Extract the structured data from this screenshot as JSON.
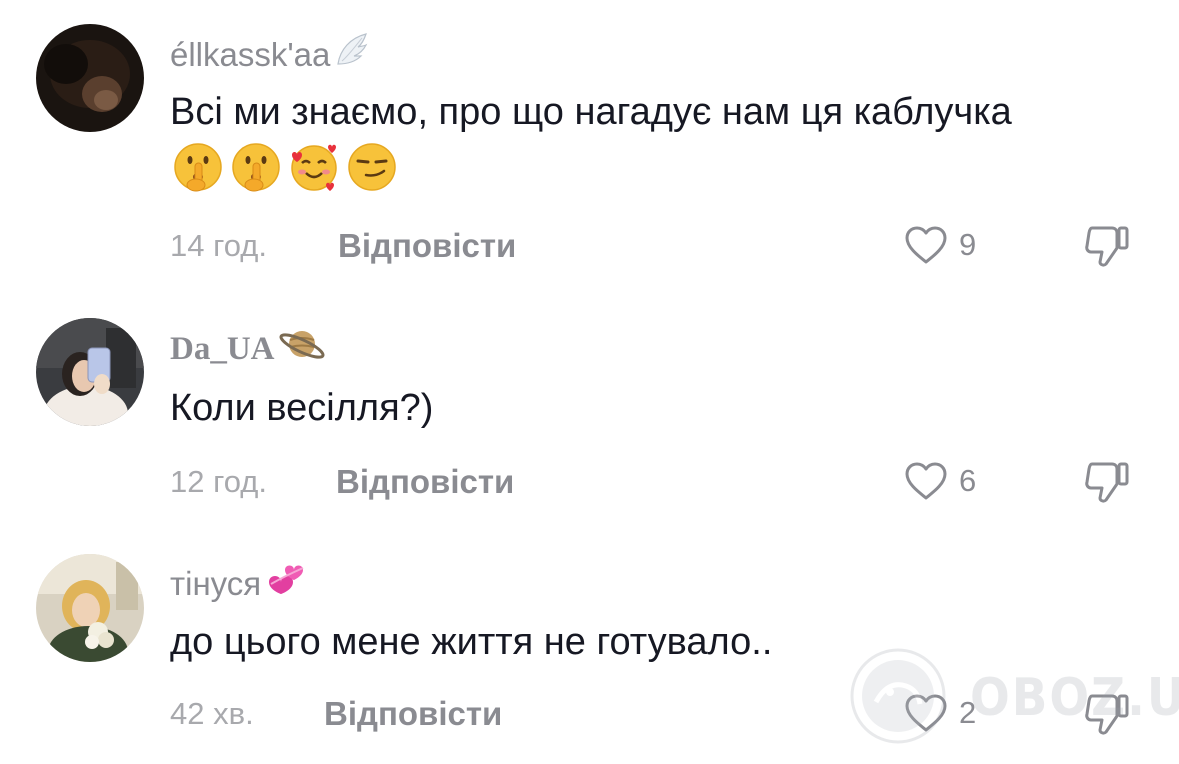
{
  "comments": [
    {
      "username": "éllkassk'aa",
      "badge_icon": "angel-wing-icon",
      "text": "Всі ми знаємо, про що нагадує нам ця каблучка",
      "emoji_icons": [
        "shushing-face-icon",
        "shushing-face-icon",
        "smiling-face-with-hearts-icon",
        "smirking-face-icon"
      ],
      "time": "14 год.",
      "reply_label": "Відповісти",
      "likes": "9"
    },
    {
      "username": "Da_UA",
      "badge_icon": "ringed-planet-icon",
      "text": "Коли весілля?)",
      "emoji_icons": [],
      "time": "12 год.",
      "reply_label": "Відповісти",
      "likes": "6"
    },
    {
      "username": "тінуся",
      "badge_icon": "revolving-hearts-icon",
      "text": "до цього мене життя не готувало..",
      "emoji_icons": [],
      "time": "42 хв.",
      "reply_label": "Відповісти",
      "likes": "2"
    }
  ],
  "icons": {
    "like": "heart-outline-icon",
    "dislike": "thumbs-down-outline-icon"
  },
  "watermark": {
    "text": "OBOZ.UA"
  },
  "colors": {
    "primary_text": "#161823",
    "secondary_text": "#8a8b91",
    "time_text": "#a8a9ad"
  }
}
